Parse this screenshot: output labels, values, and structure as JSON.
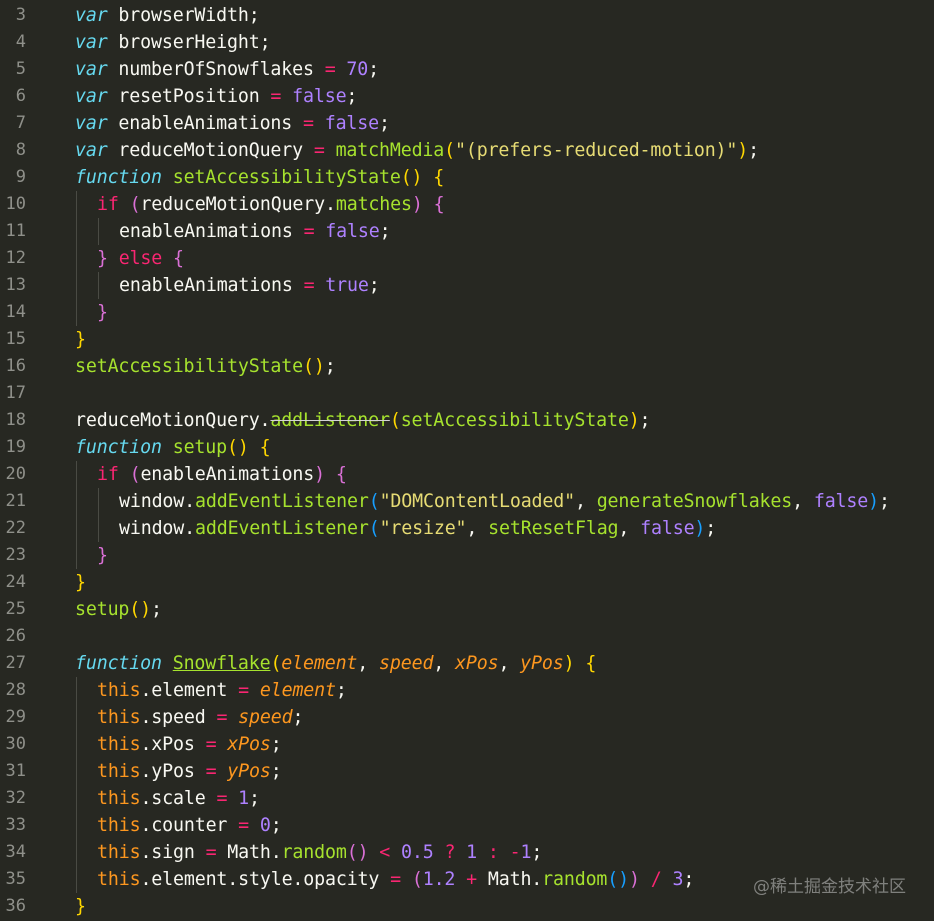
{
  "editor": {
    "theme": {
      "background": "#272822",
      "line_number": "#8f908a",
      "default_text": "#f8f8f2"
    },
    "lines": [
      {
        "number": "3",
        "indent": 0,
        "tokens": [
          [
            "keyword-italic",
            "var"
          ],
          [
            "plain",
            " browserWidth;"
          ]
        ]
      },
      {
        "number": "4",
        "indent": 0,
        "tokens": [
          [
            "keyword-italic",
            "var"
          ],
          [
            "plain",
            " browserHeight;"
          ]
        ]
      },
      {
        "number": "5",
        "indent": 0,
        "tokens": [
          [
            "keyword-italic",
            "var"
          ],
          [
            "plain",
            " numberOfSnowflakes "
          ],
          [
            "op",
            "="
          ],
          [
            "plain",
            " "
          ],
          [
            "num",
            "70"
          ],
          [
            "plain",
            ";"
          ]
        ]
      },
      {
        "number": "6",
        "indent": 0,
        "tokens": [
          [
            "keyword-italic",
            "var"
          ],
          [
            "plain",
            " resetPosition "
          ],
          [
            "op",
            "="
          ],
          [
            "plain",
            " "
          ],
          [
            "bool",
            "false"
          ],
          [
            "plain",
            ";"
          ]
        ]
      },
      {
        "number": "7",
        "indent": 0,
        "tokens": [
          [
            "keyword-italic",
            "var"
          ],
          [
            "plain",
            " enableAnimations "
          ],
          [
            "op",
            "="
          ],
          [
            "plain",
            " "
          ],
          [
            "bool",
            "false"
          ],
          [
            "plain",
            ";"
          ]
        ]
      },
      {
        "number": "8",
        "indent": 0,
        "tokens": [
          [
            "keyword-italic",
            "var"
          ],
          [
            "plain",
            " reduceMotionQuery "
          ],
          [
            "op",
            "="
          ],
          [
            "plain",
            " "
          ],
          [
            "func",
            "matchMedia"
          ],
          [
            "p1",
            "("
          ],
          [
            "str",
            "\"(prefers-reduced-motion)\""
          ],
          [
            "p1",
            ")"
          ],
          [
            "plain",
            ";"
          ]
        ]
      },
      {
        "number": "9",
        "indent": 0,
        "tokens": [
          [
            "keyword-italic",
            "function"
          ],
          [
            "plain",
            " "
          ],
          [
            "func",
            "setAccessibilityState"
          ],
          [
            "p1",
            "()"
          ],
          [
            "plain",
            " "
          ],
          [
            "p1",
            "{"
          ]
        ]
      },
      {
        "number": "10",
        "indent": 1,
        "tokens": [
          [
            "keyword",
            "if"
          ],
          [
            "plain",
            " "
          ],
          [
            "p2",
            "("
          ],
          [
            "plain",
            "reduceMotionQuery."
          ],
          [
            "func",
            "matches"
          ],
          [
            "p2",
            ")"
          ],
          [
            "plain",
            " "
          ],
          [
            "p2",
            "{"
          ]
        ]
      },
      {
        "number": "11",
        "indent": 2,
        "tokens": [
          [
            "plain",
            "enableAnimations "
          ],
          [
            "op",
            "="
          ],
          [
            "plain",
            " "
          ],
          [
            "bool",
            "false"
          ],
          [
            "plain",
            ";"
          ]
        ]
      },
      {
        "number": "12",
        "indent": 1,
        "tokens": [
          [
            "p2",
            "}"
          ],
          [
            "plain",
            " "
          ],
          [
            "keyword",
            "else"
          ],
          [
            "plain",
            " "
          ],
          [
            "p2",
            "{"
          ]
        ]
      },
      {
        "number": "13",
        "indent": 2,
        "tokens": [
          [
            "plain",
            "enableAnimations "
          ],
          [
            "op",
            "="
          ],
          [
            "plain",
            " "
          ],
          [
            "bool",
            "true"
          ],
          [
            "plain",
            ";"
          ]
        ]
      },
      {
        "number": "14",
        "indent": 1,
        "tokens": [
          [
            "p2",
            "}"
          ]
        ]
      },
      {
        "number": "15",
        "indent": 0,
        "tokens": [
          [
            "p1",
            "}"
          ]
        ]
      },
      {
        "number": "16",
        "indent": 0,
        "tokens": [
          [
            "func",
            "setAccessibilityState"
          ],
          [
            "p1",
            "()"
          ],
          [
            "plain",
            ";"
          ]
        ]
      },
      {
        "number": "17",
        "indent": 0,
        "tokens": []
      },
      {
        "number": "18",
        "indent": 0,
        "tokens": [
          [
            "plain",
            "reduceMotionQuery."
          ],
          [
            "func-deprecated",
            "addListener"
          ],
          [
            "p1",
            "("
          ],
          [
            "func",
            "setAccessibilityState"
          ],
          [
            "p1",
            ")"
          ],
          [
            "plain",
            ";"
          ]
        ]
      },
      {
        "number": "19",
        "indent": 0,
        "tokens": [
          [
            "keyword-italic",
            "function"
          ],
          [
            "plain",
            " "
          ],
          [
            "func",
            "setup"
          ],
          [
            "p1",
            "()"
          ],
          [
            "plain",
            " "
          ],
          [
            "p1",
            "{"
          ]
        ]
      },
      {
        "number": "20",
        "indent": 1,
        "tokens": [
          [
            "keyword",
            "if"
          ],
          [
            "plain",
            " "
          ],
          [
            "p2",
            "("
          ],
          [
            "plain",
            "enableAnimations"
          ],
          [
            "p2",
            ")"
          ],
          [
            "plain",
            " "
          ],
          [
            "p2",
            "{"
          ]
        ]
      },
      {
        "number": "21",
        "indent": 2,
        "tokens": [
          [
            "plain",
            "window."
          ],
          [
            "func",
            "addEventListener"
          ],
          [
            "p3",
            "("
          ],
          [
            "str",
            "\"DOMContentLoaded\""
          ],
          [
            "plain",
            ", "
          ],
          [
            "func",
            "generateSnowflakes"
          ],
          [
            "plain",
            ", "
          ],
          [
            "bool",
            "false"
          ],
          [
            "p3",
            ")"
          ],
          [
            "plain",
            ";"
          ]
        ]
      },
      {
        "number": "22",
        "indent": 2,
        "tokens": [
          [
            "plain",
            "window."
          ],
          [
            "func",
            "addEventListener"
          ],
          [
            "p3",
            "("
          ],
          [
            "str",
            "\"resize\""
          ],
          [
            "plain",
            ", "
          ],
          [
            "func",
            "setResetFlag"
          ],
          [
            "plain",
            ", "
          ],
          [
            "bool",
            "false"
          ],
          [
            "p3",
            ")"
          ],
          [
            "plain",
            ";"
          ]
        ]
      },
      {
        "number": "23",
        "indent": 1,
        "tokens": [
          [
            "p2",
            "}"
          ]
        ]
      },
      {
        "number": "24",
        "indent": 0,
        "tokens": [
          [
            "p1",
            "}"
          ]
        ]
      },
      {
        "number": "25",
        "indent": 0,
        "tokens": [
          [
            "func",
            "setup"
          ],
          [
            "p1",
            "()"
          ],
          [
            "plain",
            ";"
          ]
        ]
      },
      {
        "number": "26",
        "indent": 0,
        "tokens": []
      },
      {
        "number": "27",
        "indent": 0,
        "tokens": [
          [
            "keyword-italic",
            "function"
          ],
          [
            "plain",
            " "
          ],
          [
            "func-underline",
            "Snowflake"
          ],
          [
            "p1",
            "("
          ],
          [
            "param",
            "element"
          ],
          [
            "plain",
            ", "
          ],
          [
            "param",
            "speed"
          ],
          [
            "plain",
            ", "
          ],
          [
            "param",
            "xPos"
          ],
          [
            "plain",
            ", "
          ],
          [
            "param",
            "yPos"
          ],
          [
            "p1",
            ")"
          ],
          [
            "plain",
            " "
          ],
          [
            "p1",
            "{"
          ]
        ]
      },
      {
        "number": "28",
        "indent": 1,
        "tokens": [
          [
            "this",
            "this"
          ],
          [
            "plain",
            ".element "
          ],
          [
            "op",
            "="
          ],
          [
            "plain",
            " "
          ],
          [
            "param",
            "element"
          ],
          [
            "plain",
            ";"
          ]
        ]
      },
      {
        "number": "29",
        "indent": 1,
        "tokens": [
          [
            "this",
            "this"
          ],
          [
            "plain",
            ".speed "
          ],
          [
            "op",
            "="
          ],
          [
            "plain",
            " "
          ],
          [
            "param",
            "speed"
          ],
          [
            "plain",
            ";"
          ]
        ]
      },
      {
        "number": "30",
        "indent": 1,
        "tokens": [
          [
            "this",
            "this"
          ],
          [
            "plain",
            ".xPos "
          ],
          [
            "op",
            "="
          ],
          [
            "plain",
            " "
          ],
          [
            "param",
            "xPos"
          ],
          [
            "plain",
            ";"
          ]
        ]
      },
      {
        "number": "31",
        "indent": 1,
        "tokens": [
          [
            "this",
            "this"
          ],
          [
            "plain",
            ".yPos "
          ],
          [
            "op",
            "="
          ],
          [
            "plain",
            " "
          ],
          [
            "param",
            "yPos"
          ],
          [
            "plain",
            ";"
          ]
        ]
      },
      {
        "number": "32",
        "indent": 1,
        "tokens": [
          [
            "this",
            "this"
          ],
          [
            "plain",
            ".scale "
          ],
          [
            "op",
            "="
          ],
          [
            "plain",
            " "
          ],
          [
            "num",
            "1"
          ],
          [
            "plain",
            ";"
          ]
        ]
      },
      {
        "number": "33",
        "indent": 1,
        "tokens": [
          [
            "this",
            "this"
          ],
          [
            "plain",
            ".counter "
          ],
          [
            "op",
            "="
          ],
          [
            "plain",
            " "
          ],
          [
            "num",
            "0"
          ],
          [
            "plain",
            ";"
          ]
        ]
      },
      {
        "number": "34",
        "indent": 1,
        "tokens": [
          [
            "this",
            "this"
          ],
          [
            "plain",
            ".sign "
          ],
          [
            "op",
            "="
          ],
          [
            "plain",
            " Math."
          ],
          [
            "func",
            "random"
          ],
          [
            "p2",
            "()"
          ],
          [
            "plain",
            " "
          ],
          [
            "op",
            "<"
          ],
          [
            "plain",
            " "
          ],
          [
            "num",
            "0.5"
          ],
          [
            "plain",
            " "
          ],
          [
            "op",
            "?"
          ],
          [
            "plain",
            " "
          ],
          [
            "num",
            "1"
          ],
          [
            "plain",
            " "
          ],
          [
            "op",
            ":"
          ],
          [
            "plain",
            " "
          ],
          [
            "op",
            "-"
          ],
          [
            "num",
            "1"
          ],
          [
            "plain",
            ";"
          ]
        ]
      },
      {
        "number": "35",
        "indent": 1,
        "tokens": [
          [
            "this",
            "this"
          ],
          [
            "plain",
            ".element.style.opacity "
          ],
          [
            "op",
            "="
          ],
          [
            "plain",
            " "
          ],
          [
            "p2",
            "("
          ],
          [
            "num",
            "1.2"
          ],
          [
            "plain",
            " "
          ],
          [
            "op",
            "+"
          ],
          [
            "plain",
            " Math."
          ],
          [
            "func",
            "random"
          ],
          [
            "p3",
            "()"
          ],
          [
            "p2",
            ")"
          ],
          [
            "plain",
            " "
          ],
          [
            "op",
            "/"
          ],
          [
            "plain",
            " "
          ],
          [
            "num",
            "3"
          ],
          [
            "plain",
            ";"
          ]
        ]
      },
      {
        "number": "36",
        "indent": 0,
        "tokens": [
          [
            "p1",
            "}"
          ]
        ]
      }
    ]
  },
  "watermark": "@稀土掘金技术社区"
}
